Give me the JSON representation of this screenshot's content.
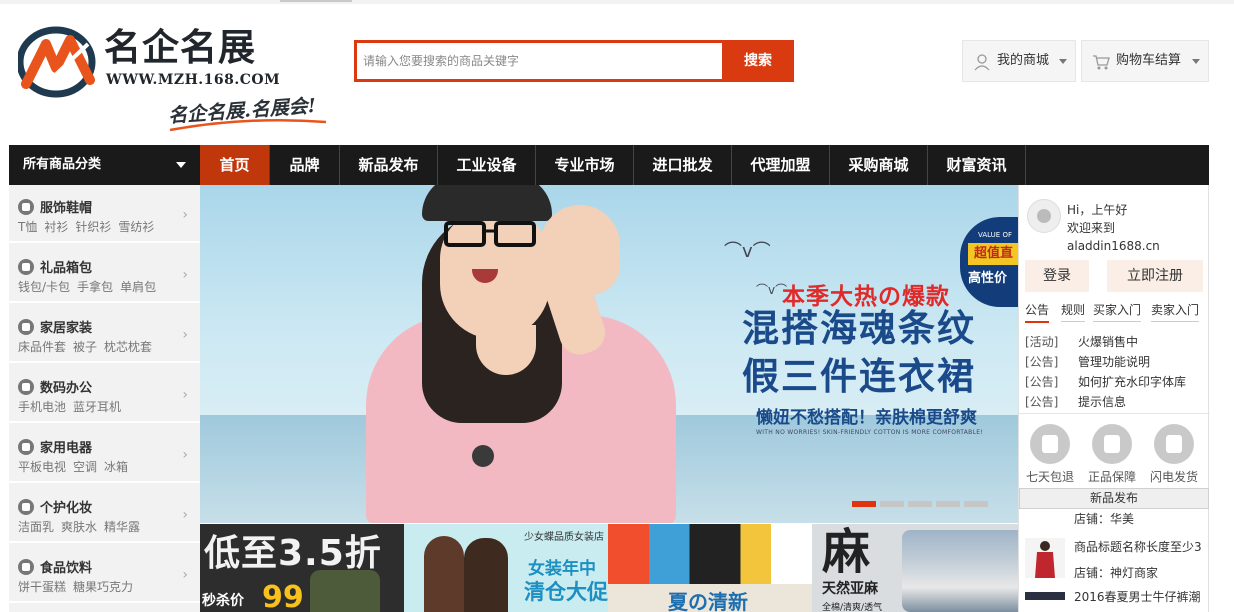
{
  "logo": {
    "cn_text": "名企名展",
    "url_text": "WWW.MZH.168.COM",
    "slogan": "名企名展.名展会!"
  },
  "search": {
    "placeholder": "请输入您要搜索的商品关键字",
    "button_label": "搜索"
  },
  "top_right": {
    "my_mall": "我的商城",
    "cart": "购物车结算"
  },
  "nav": {
    "all_categories": "所有商品分类",
    "items": [
      "首页",
      "品牌",
      "新品发布",
      "工业设备",
      "专业市场",
      "进口批发",
      "代理加盟",
      "采购商城",
      "财富资讯"
    ],
    "active_index": 0
  },
  "categories": [
    {
      "title": "服饰鞋帽",
      "subs": [
        "T恤",
        "衬衫",
        "针织衫",
        "雪纺衫"
      ]
    },
    {
      "title": "礼品箱包",
      "subs": [
        "钱包/卡包",
        "手拿包",
        "单肩包"
      ]
    },
    {
      "title": "家居家装",
      "subs": [
        "床品件套",
        "被子",
        "枕芯枕套"
      ]
    },
    {
      "title": "数码办公",
      "subs": [
        "手机电池",
        "蓝牙耳机"
      ]
    },
    {
      "title": "家用电器",
      "subs": [
        "平板电视",
        "空调",
        "冰箱"
      ]
    },
    {
      "title": "个护化妆",
      "subs": [
        "洁面乳",
        "爽肤水",
        "精华露"
      ]
    },
    {
      "title": "食品饮料",
      "subs": [
        "饼干蛋糕",
        "糖果巧克力"
      ]
    }
  ],
  "banner": {
    "headline_red": "本季大热の爆款",
    "headline_1": "混搭海魂条纹",
    "headline_2": "假三件连衣裙",
    "subline": "懒妞不愁搭配！亲肤棉更舒爽",
    "tiny": "WITH NO WORRIES! SKIN-FRIENDLY COTTON IS MORE COMFORTABLE!",
    "badge_top": "VALUE OF",
    "badge_mid": "超值直",
    "badge_bot": "高性价",
    "slide_count": 5,
    "active_slide": 0
  },
  "thumbs": {
    "t1_big": "低至3.5折",
    "t1_sec": "秒杀价",
    "t1_price": "99",
    "t2_shop": "少女蝶品质女装店",
    "t2_promo1": "女装年中",
    "t2_promo2": "清仓大促",
    "t3_text": "夏の清新",
    "t4_ma": "麻",
    "t4_l1": "天然亚麻",
    "t4_l2": "全棉/清爽/透气"
  },
  "user_panel": {
    "greeting": "Hi，上午好",
    "welcome": "欢迎来到 aladdin1688.cn",
    "login": "登录",
    "register": "立即注册",
    "tabs": [
      "公告",
      "规则",
      "买家入门",
      "卖家入门"
    ],
    "active_tab": 0,
    "notices": [
      {
        "tag": "[活动]",
        "title": "火爆销售中"
      },
      {
        "tag": "[公告]",
        "title": "管理功能说明"
      },
      {
        "tag": "[公告]",
        "title": "如何扩充水印字体库"
      },
      {
        "tag": "[公告]",
        "title": "提示信息"
      }
    ],
    "services": [
      "七天包退",
      "正品保障",
      "闪电发货"
    ],
    "new_header": "新品发布",
    "new_products": [
      {
        "shop": "店铺：华美"
      },
      {
        "title": "商品标题名称长度至少3",
        "shop": "店铺：神灯商家"
      },
      {
        "title": "2016春夏男士牛仔裤潮"
      }
    ]
  },
  "colors": {
    "accent": "#d93a0f",
    "nav_bg": "#1a1a1a",
    "nav_active": "#c0370c"
  }
}
